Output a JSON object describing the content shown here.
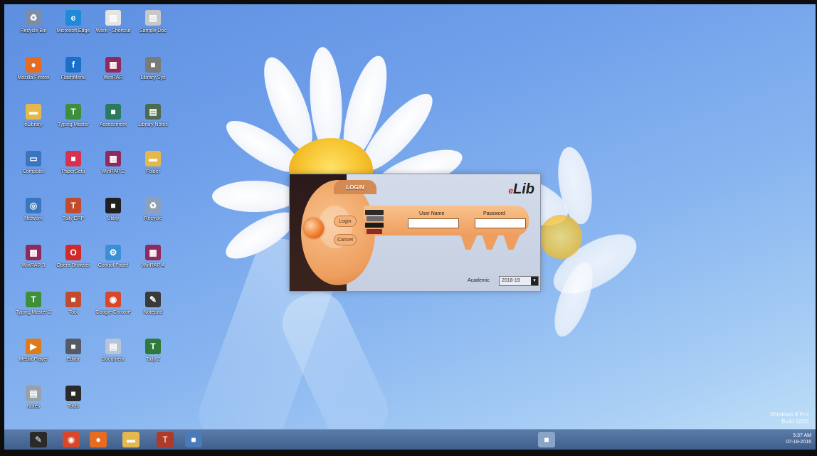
{
  "desktop": {
    "icons": [
      {
        "label": "Recycle Bin",
        "icon": "recycle-bin-icon",
        "color": "#7c8da8"
      },
      {
        "label": "Microsoft Edge",
        "icon": "edge-icon",
        "color": "#1f8ad8"
      },
      {
        "label": "Work - Shortcut",
        "icon": "document-icon",
        "color": "#e4e4e4"
      },
      {
        "label": "Sample Doc",
        "icon": "document-icon",
        "color": "#c8c8c8"
      },
      {
        "label": "Mozilla Firefox",
        "icon": "firefox-icon",
        "color": "#e66c21"
      },
      {
        "label": "FlashMenu",
        "icon": "flash-icon",
        "color": "#1a6fc9"
      },
      {
        "label": "WinRAR",
        "icon": "winrar-icon",
        "color": "#8e2b5c"
      },
      {
        "label": "Library Sys",
        "icon": "application-icon",
        "color": "#7a7a7a"
      },
      {
        "label": "eLibrary",
        "icon": "folder-icon",
        "color": "#e4b84c"
      },
      {
        "label": "Typing Master",
        "icon": "typing-icon",
        "color": "#3d8f3a"
      },
      {
        "label": "Assessment",
        "icon": "application-icon",
        "color": "#2c7a5e"
      },
      {
        "label": "Library Notes",
        "icon": "document-icon",
        "color": "#4d6b4d"
      },
      {
        "label": "Computer",
        "icon": "computer-icon",
        "color": "#3a75c0"
      },
      {
        "label": "PaperSetu",
        "icon": "application-icon",
        "color": "#d6314e"
      },
      {
        "label": "WinRAR 2",
        "icon": "winrar-icon",
        "color": "#8e2b5c"
      },
      {
        "label": "Folder",
        "icon": "folder-icon",
        "color": "#e4b84c"
      },
      {
        "label": "Network",
        "icon": "network-icon",
        "color": "#3a75c0"
      },
      {
        "label": "Tally ERP",
        "icon": "tally-icon",
        "color": "#c24b2e"
      },
      {
        "label": "Utility",
        "icon": "application-icon",
        "color": "#202020"
      },
      {
        "label": "Recycle",
        "icon": "recycle-bin-icon",
        "color": "#8ea0bc"
      },
      {
        "label": "WinRAR 3",
        "icon": "winrar-icon",
        "color": "#8e2b5c"
      },
      {
        "label": "Opera Browser",
        "icon": "opera-icon",
        "color": "#d22a2a"
      },
      {
        "label": "Control Panel",
        "icon": "control-panel-icon",
        "color": "#3a8fd6"
      },
      {
        "label": "WinRAR 4",
        "icon": "winrar-icon",
        "color": "#8e2b5c"
      },
      {
        "label": "Typing Master 2",
        "icon": "typing-icon",
        "color": "#3d8f3a"
      },
      {
        "label": "Tool",
        "icon": "application-icon",
        "color": "#c24b2e"
      },
      {
        "label": "Google Chrome",
        "icon": "chrome-icon",
        "color": "#d9472b"
      },
      {
        "label": "Notepad",
        "icon": "notepad-icon",
        "color": "#3a3a3a"
      },
      {
        "label": "Media Player",
        "icon": "media-icon",
        "color": "#e07b1b"
      },
      {
        "label": "Editor",
        "icon": "application-icon",
        "color": "#555a66"
      },
      {
        "label": "Document",
        "icon": "document-icon",
        "color": "#b9c4d6"
      },
      {
        "label": "Tally 2",
        "icon": "tally-icon",
        "color": "#2f7a3a"
      },
      {
        "label": "Notes",
        "icon": "notes-icon",
        "color": "#9aa0aa"
      },
      {
        "label": "Tools",
        "icon": "application-icon",
        "color": "#2a2a2a"
      }
    ]
  },
  "login": {
    "ribbon": "LOGIN",
    "logo_prefix": "e",
    "logo": "Lib",
    "login_button": "Login",
    "cancel_button": "Cancel",
    "username_label": "User Name",
    "password_label": "Password",
    "username_value": "",
    "password_value": "",
    "academic_label": "Academic",
    "academic_value": "2018-19"
  },
  "taskbar": {
    "items": [
      {
        "icon": "notepad-icon",
        "color": "#2a2a2a"
      },
      {
        "icon": "chrome-icon",
        "color": "#d9472b"
      },
      {
        "icon": "firefox-icon",
        "color": "#e66c21"
      },
      {
        "icon": "folder-icon",
        "color": "#e4b84c"
      },
      {
        "icon": "tally-icon",
        "color": "#b03a2a"
      },
      {
        "icon": "application-icon",
        "color": "#4a7ab8"
      },
      {
        "icon": "application-icon",
        "color": "#8aa4c8"
      }
    ],
    "time": "5:37 AM",
    "date": "07-18-2016"
  },
  "watermark": {
    "line1": "Windows 8 Pro",
    "line2": "Build 9200"
  }
}
